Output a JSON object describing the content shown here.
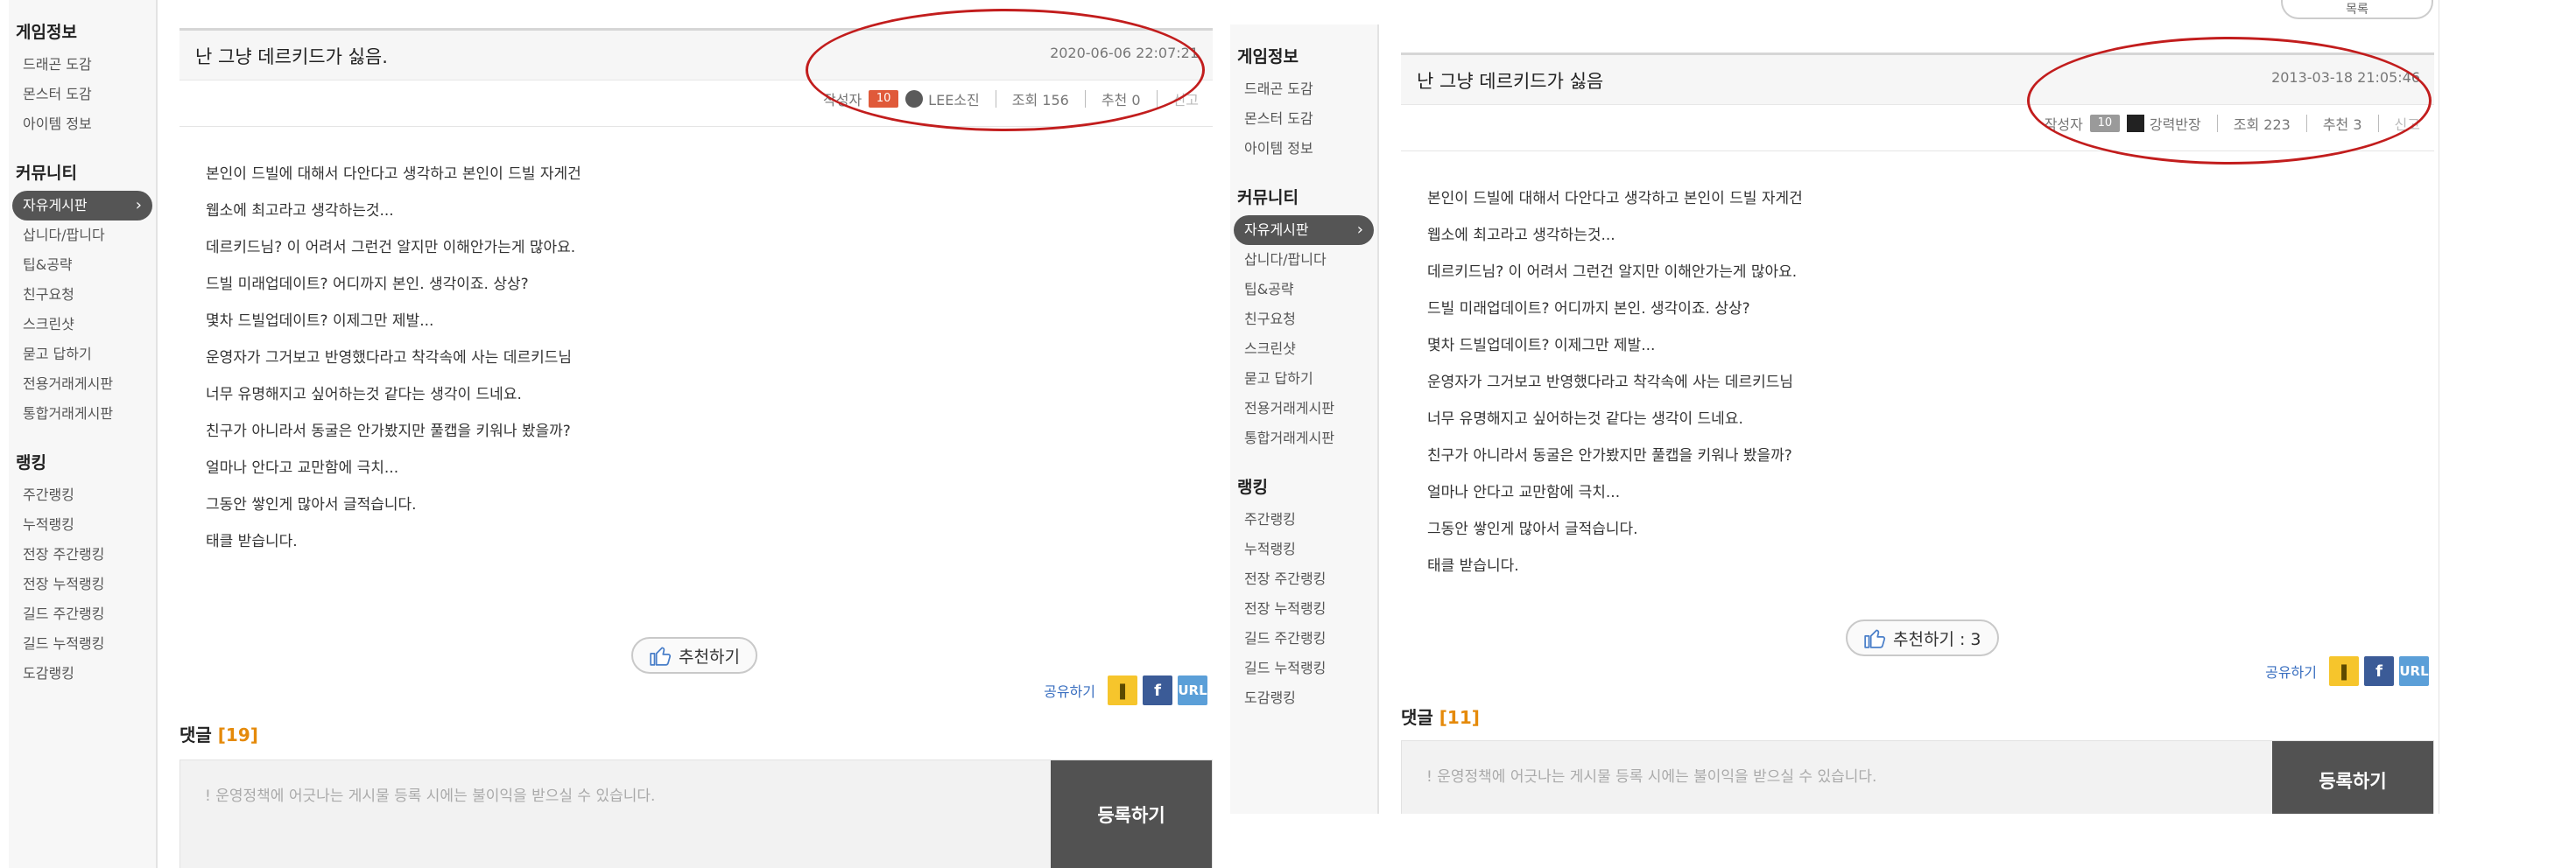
{
  "sidebar": {
    "sections": [
      {
        "title": "게임정보",
        "items": [
          "드래곤 도감",
          "몬스터 도감",
          "아이템 정보"
        ]
      },
      {
        "title": "커뮤니티",
        "items": [
          "자유게시판",
          "삽니다/팝니다",
          "팁&공략",
          "친구요청",
          "스크린샷",
          "묻고 답하기",
          "전용거래게시판",
          "통합거래게시판"
        ]
      },
      {
        "title": "랭킹",
        "items": [
          "주간랭킹",
          "누적랭킹",
          "전장 주간랭킹",
          "전장 누적랭킹",
          "길드 주간랭킹",
          "길드 누적랭킹",
          "도감랭킹"
        ]
      }
    ],
    "active": "자유게시판"
  },
  "left": {
    "title": "난 그냥 데르키드가 싫음.",
    "date": "2020-06-06 22:07:21",
    "author_label": "작성자",
    "level": "10",
    "level_color": "#e05a3a",
    "author": "LEE소진",
    "views": "조회 156",
    "recommends": "추천 0",
    "report": "신고",
    "reco_button": "추천하기",
    "comment_label": "댓글",
    "comment_count": "[19]"
  },
  "right": {
    "top_stub": "목록",
    "title": "난 그냥 데르키드가 싫음",
    "date": "2013-03-18 21:05:46",
    "author_label": "작성자",
    "level": "10",
    "level_color": "#9a9a9a",
    "author": "강력반장",
    "views": "조회 223",
    "recommends": "추천 3",
    "report": "신고",
    "reco_button": "추천하기 : 3",
    "comment_label": "댓글",
    "comment_count": "[11]"
  },
  "body_lines": [
    "본인이 드빌에 대해서 다안다고 생각하고 본인이 드빌  자게건",
    "웹소에 최고라고 생각하는것...",
    "데르키드님? 이 어려서 그런건 알지만 이해안가는게 많아요.",
    "드빌 미래업데이트? 어디까지 본인.  생각이죠. 상상?",
    "몇차 드빌업데이트? 이제그만 제발...",
    "운영자가 그거보고 반영했다라고 착각속에 사는 데르키드님",
    "너무 유명해지고 싶어하는것 같다는 생각이 드네요.",
    "친구가 아니라서 동굴은 안가봤지만 풀캡을 키워나 봤을까?",
    "얼마나 안다고 교만함에 극치...",
    "그동안 쌓인게 많아서 글적습니다.",
    "태클 받습니다."
  ],
  "share": {
    "label": "공유하기",
    "url_label": "URL"
  },
  "comment_placeholder": "! 운영정책에 어긋나는 게시물 등록 시에는 불이익을 받으실 수 있습니다.",
  "submit_label": "등록하기",
  "annotation_color": "#c21d1d"
}
